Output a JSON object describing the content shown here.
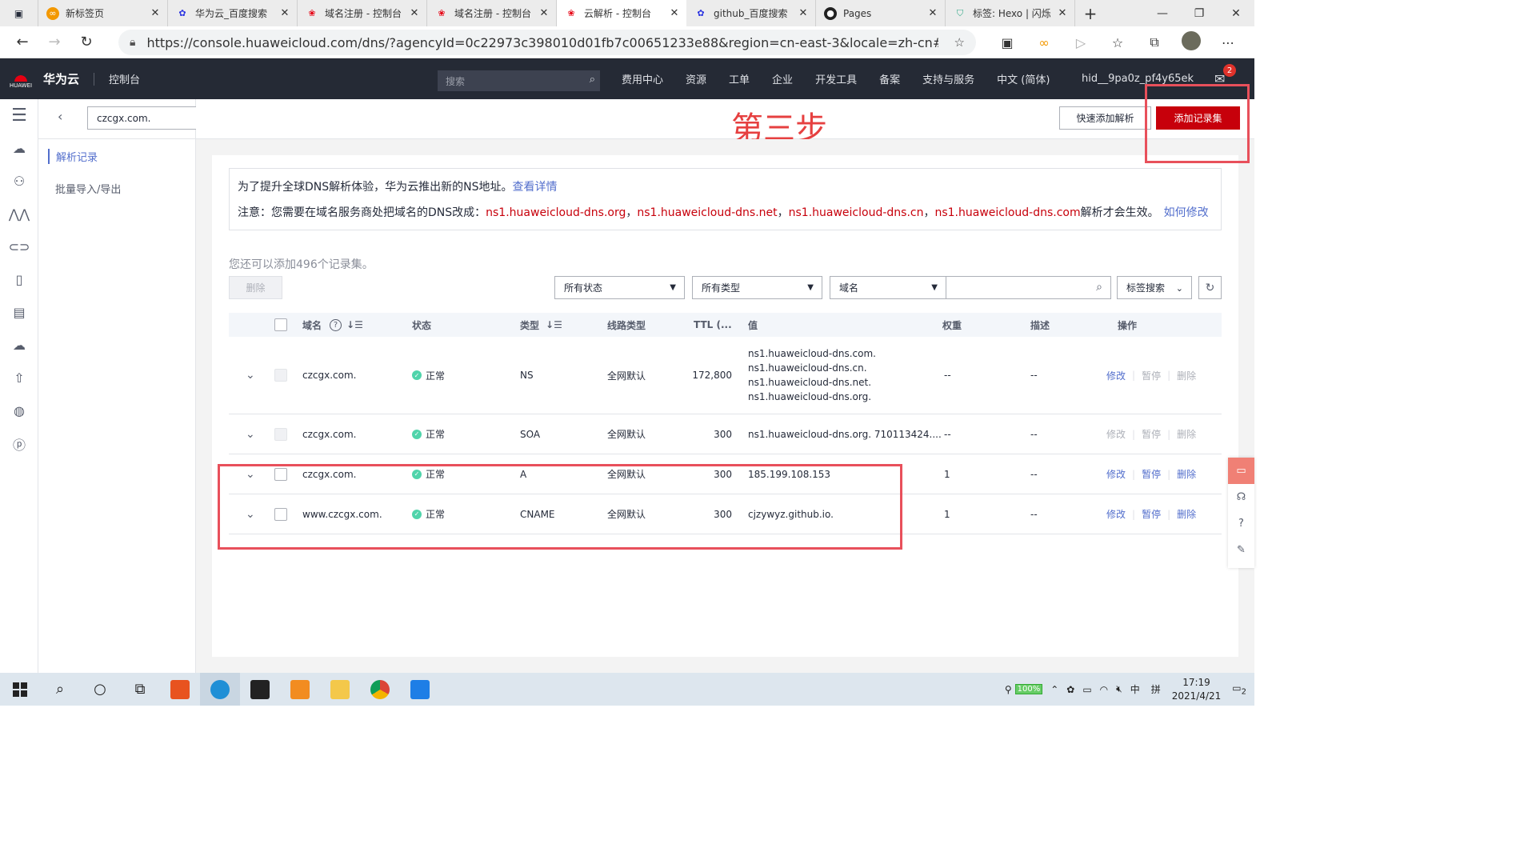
{
  "browser": {
    "tabs": [
      {
        "title": "新标签页",
        "active": false
      },
      {
        "title": "华为云_百度搜索",
        "active": false
      },
      {
        "title": "域名注册 - 控制台",
        "active": false
      },
      {
        "title": "域名注册 - 控制台",
        "active": false
      },
      {
        "title": "云解析 - 控制台",
        "active": true
      },
      {
        "title": "github_百度搜索",
        "active": false
      },
      {
        "title": "Pages",
        "active": false
      },
      {
        "title": "标签: Hexo | 闪烁",
        "active": false
      }
    ],
    "url": "https://console.huaweicloud.com/dns/?agencyId=0c22973c398010d01fb7c00651233e88&region=cn-east-3&locale=zh-cn#/dns/public..."
  },
  "topnav": {
    "logo_text": "HUAWEI",
    "brand": "华为云",
    "console": "控制台",
    "search_placeholder": "搜索",
    "items": [
      "费用中心",
      "资源",
      "工单",
      "企业",
      "开发工具",
      "备案",
      "支持与服务",
      "中文 (简体)"
    ],
    "user": "hid__9pa0z_pf4y65ek",
    "mail_count": "2"
  },
  "sidebar": {
    "domain_select": "czcgx.com.",
    "items": [
      "解析记录",
      "批量导入/导出"
    ]
  },
  "annotation": {
    "step": "第三步"
  },
  "header": {
    "quick_add": "快速添加解析",
    "add_record": "添加记录集"
  },
  "notice": {
    "line1": "为了提升全球DNS解析体验，华为云推出新的NS地址。",
    "line1_link": "查看详情",
    "line2_prefix": "注意：您需要在域名服务商处把域名的DNS改成：",
    "ns": [
      "ns1.huaweicloud-dns.org",
      "ns1.huaweicloud-dns.net",
      "ns1.huaweicloud-dns.cn",
      "ns1.huaweicloud-dns.com"
    ],
    "sep": "，",
    "line2_suffix": "解析才会生效。",
    "line2_link": "如何修改"
  },
  "toolbar": {
    "quota": "您还可以添加496个记录集。",
    "delete": "删除",
    "status_filter": "所有状态",
    "type_filter": "所有类型",
    "field_filter": "域名",
    "tag_search": "标签搜索"
  },
  "table": {
    "headers": {
      "domain": "域名",
      "status": "状态",
      "type": "类型",
      "line": "线路类型",
      "ttl": "TTL (...",
      "value": "值",
      "weight": "权重",
      "desc": "描述",
      "ops": "操作"
    },
    "rows": [
      {
        "domain": "czcgx.com.",
        "status": "正常",
        "type": "NS",
        "line": "全网默认",
        "ttl": "172,800",
        "values": [
          "ns1.huaweicloud-dns.com.",
          "ns1.huaweicloud-dns.cn.",
          "ns1.huaweicloud-dns.net.",
          "ns1.huaweicloud-dns.org."
        ],
        "weight": "--",
        "desc": "--",
        "ops": [
          "修改",
          "暂停",
          "删除"
        ],
        "enabled_ops": [
          true,
          false,
          false
        ],
        "checkbox_enabled": false
      },
      {
        "domain": "czcgx.com.",
        "status": "正常",
        "type": "SOA",
        "line": "全网默认",
        "ttl": "300",
        "values": [
          "ns1.huaweicloud-dns.org. 710113424...."
        ],
        "weight": "--",
        "desc": "--",
        "ops": [
          "修改",
          "暂停",
          "删除"
        ],
        "enabled_ops": [
          false,
          false,
          false
        ],
        "checkbox_enabled": false
      },
      {
        "domain": "czcgx.com.",
        "status": "正常",
        "type": "A",
        "line": "全网默认",
        "ttl": "300",
        "values": [
          "185.199.108.153"
        ],
        "weight": "1",
        "desc": "--",
        "ops": [
          "修改",
          "暂停",
          "删除"
        ],
        "enabled_ops": [
          true,
          true,
          true
        ],
        "checkbox_enabled": true
      },
      {
        "domain": "www.czcgx.com.",
        "status": "正常",
        "type": "CNAME",
        "line": "全网默认",
        "ttl": "300",
        "values": [
          "cjzywyz.github.io."
        ],
        "weight": "1",
        "desc": "--",
        "ops": [
          "修改",
          "暂停",
          "删除"
        ],
        "enabled_ops": [
          true,
          true,
          true
        ],
        "checkbox_enabled": true
      }
    ]
  },
  "taskbar": {
    "battery": "100%",
    "ime": "中",
    "ime2": "拼",
    "time": "17:19",
    "date": "2021/4/21",
    "notifications": "2"
  },
  "colors": {
    "accent": "#526ecc",
    "brand_red": "#c7000b",
    "annotation_red": "#e8505b",
    "ok": "#50d4ab",
    "topbar": "#252a35"
  }
}
